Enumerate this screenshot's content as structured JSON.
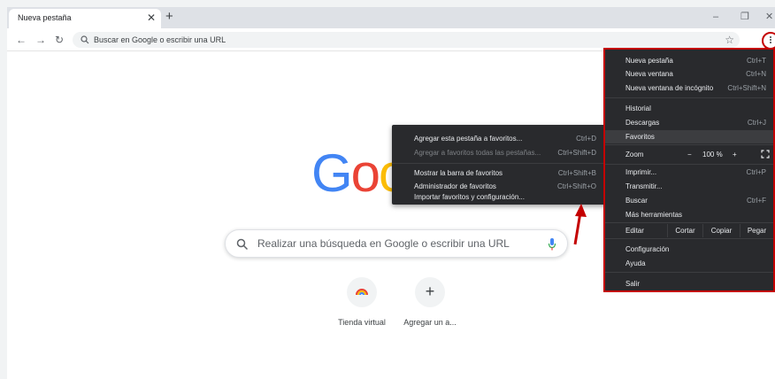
{
  "tab": {
    "title": "Nueva pestaña"
  },
  "toolbar": {
    "omnibox_text": "Buscar en Google o escribir una URL"
  },
  "logo": {
    "visible_text": "Goo"
  },
  "search": {
    "placeholder": "Realizar una búsqueda en Google o escribir una URL"
  },
  "shortcuts": [
    {
      "label": "Tienda virtual"
    },
    {
      "label": "Agregar un a..."
    }
  ],
  "bookmarks_submenu": {
    "items": [
      {
        "label": "Agregar esta pestaña a favoritos...",
        "shortcut": "Ctrl+D",
        "enabled": true
      },
      {
        "label": "Agregar a favoritos todas las pestañas...",
        "shortcut": "Ctrl+Shift+D",
        "enabled": false
      },
      {
        "label": "Mostrar la barra de favoritos",
        "shortcut": "Ctrl+Shift+B",
        "enabled": true
      },
      {
        "label": "Administrador de favoritos",
        "shortcut": "Ctrl+Shift+O",
        "enabled": true
      },
      {
        "label": "Importar favoritos y configuración...",
        "shortcut": "",
        "enabled": true
      }
    ]
  },
  "main_menu": {
    "new_tab": {
      "label": "Nueva pestaña",
      "shortcut": "Ctrl+T"
    },
    "new_window": {
      "label": "Nueva ventana",
      "shortcut": "Ctrl+N"
    },
    "incognito": {
      "label": "Nueva ventana de incógnito",
      "shortcut": "Ctrl+Shift+N"
    },
    "history": {
      "label": "Historial"
    },
    "downloads": {
      "label": "Descargas",
      "shortcut": "Ctrl+J"
    },
    "bookmarks": {
      "label": "Favoritos"
    },
    "zoom": {
      "label": "Zoom",
      "minus": "−",
      "value": "100 %",
      "plus": "+"
    },
    "print": {
      "label": "Imprimir...",
      "shortcut": "Ctrl+P"
    },
    "cast": {
      "label": "Transmitir..."
    },
    "find": {
      "label": "Buscar",
      "shortcut": "Ctrl+F"
    },
    "more_tools": {
      "label": "Más herramientas"
    },
    "edit": {
      "label": "Editar",
      "cut": "Cortar",
      "copy": "Copiar",
      "paste": "Pegar"
    },
    "settings": {
      "label": "Configuración"
    },
    "help": {
      "label": "Ayuda"
    },
    "exit": {
      "label": "Salir"
    }
  },
  "colors": {
    "menu_bg": "#292a2d",
    "highlight_border": "#c40000",
    "arrow": "#c40000"
  }
}
